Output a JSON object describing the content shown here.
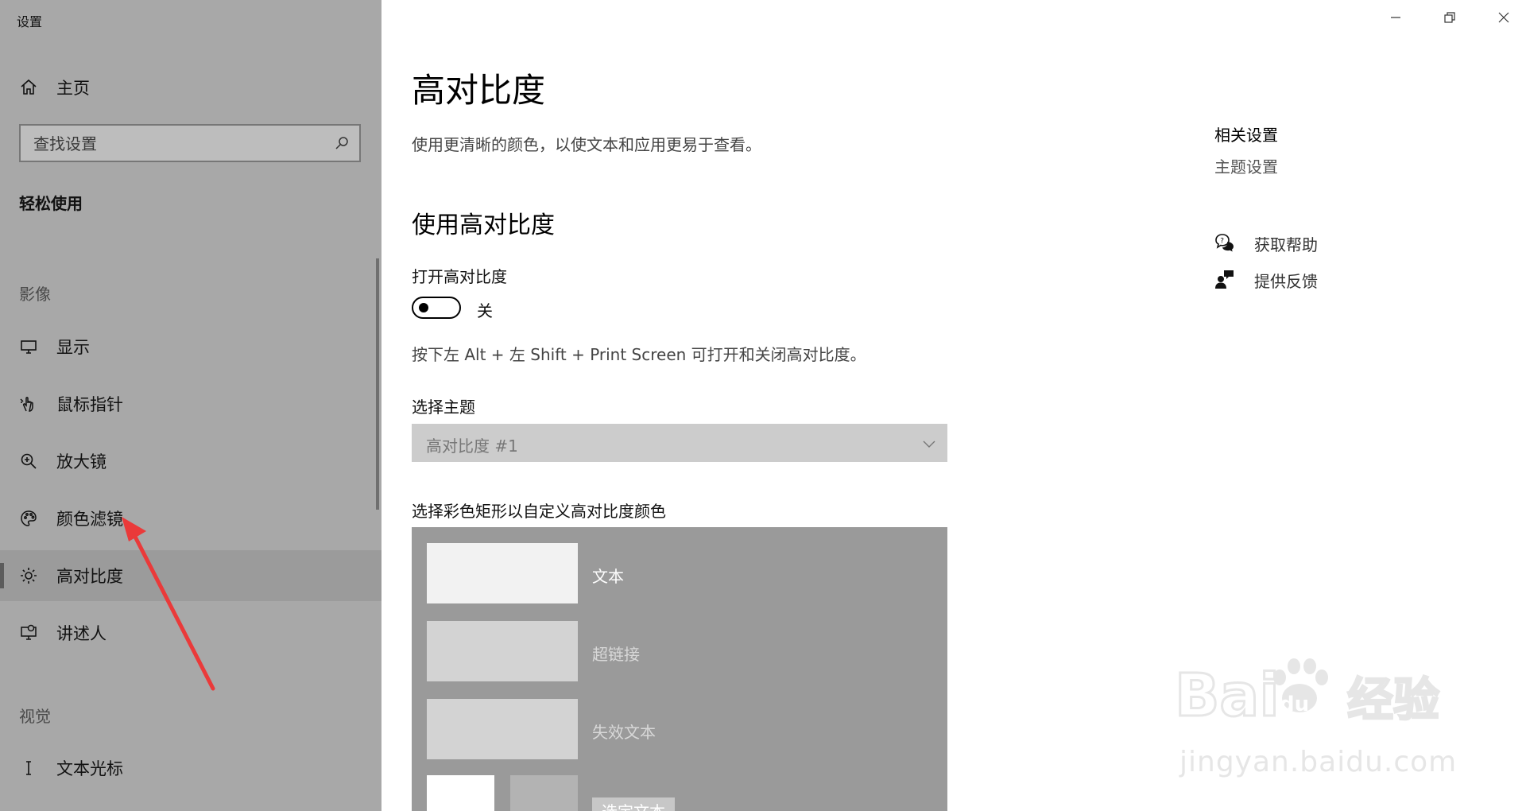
{
  "window": {
    "app_title": "设置",
    "minimize_icon": "minimize-icon",
    "restore_icon": "restore-icon",
    "close_icon": "close-icon"
  },
  "sidebar": {
    "home_label": "主页",
    "search_placeholder": "查找设置",
    "group_title": "轻松使用",
    "category_vision": "影像",
    "items": [
      {
        "label": "显示",
        "icon": "monitor-icon"
      },
      {
        "label": "鼠标指针",
        "icon": "pointer-icon"
      },
      {
        "label": "放大镜",
        "icon": "magnifier-icon"
      },
      {
        "label": "颜色滤镜",
        "icon": "palette-icon"
      },
      {
        "label": "高对比度",
        "icon": "brightness-icon",
        "selected": true
      },
      {
        "label": "讲述人",
        "icon": "narrator-icon"
      }
    ],
    "category_visual": "视觉",
    "items2": [
      {
        "label": "文本光标",
        "icon": "text-cursor-icon"
      }
    ]
  },
  "main": {
    "title": "高对比度",
    "description": "使用更清晰的颜色，以使文本和应用更易于查看。",
    "section_title": "使用高对比度",
    "toggle_label": "打开高对比度",
    "toggle_state": "关",
    "shortcut_hint": "按下左 Alt + 左 Shift + Print Screen 可打开和关闭高对比度。",
    "theme_label": "选择主题",
    "theme_value": "高对比度 #1",
    "color_label": "选择彩色矩形以自定义高对比度颜色",
    "swatches": [
      {
        "label": "文本",
        "color": "#f2f2f2",
        "text_color": "#ffffff"
      },
      {
        "label": "超链接",
        "color": "#d3d3d3",
        "text_color": "#d8d8d8"
      },
      {
        "label": "失效文本",
        "color": "#d3d3d3",
        "text_color": "#d8d8d8"
      }
    ],
    "selected_text_label": "选定文本"
  },
  "related": {
    "title": "相关设置",
    "theme_settings": "主题设置",
    "get_help": "获取帮助",
    "give_feedback": "提供反馈"
  },
  "watermark": {
    "brand": "Bai du 经验",
    "domain": "jingyan.baidu.com"
  },
  "colors": {
    "sidebar_bg": "#a8a8a8",
    "selected_bg": "#9b9b9b",
    "annotation_arrow": "#ea3a3a",
    "theme_select_bg": "#cccccc",
    "color_panel_bg": "#9a9a9a"
  }
}
